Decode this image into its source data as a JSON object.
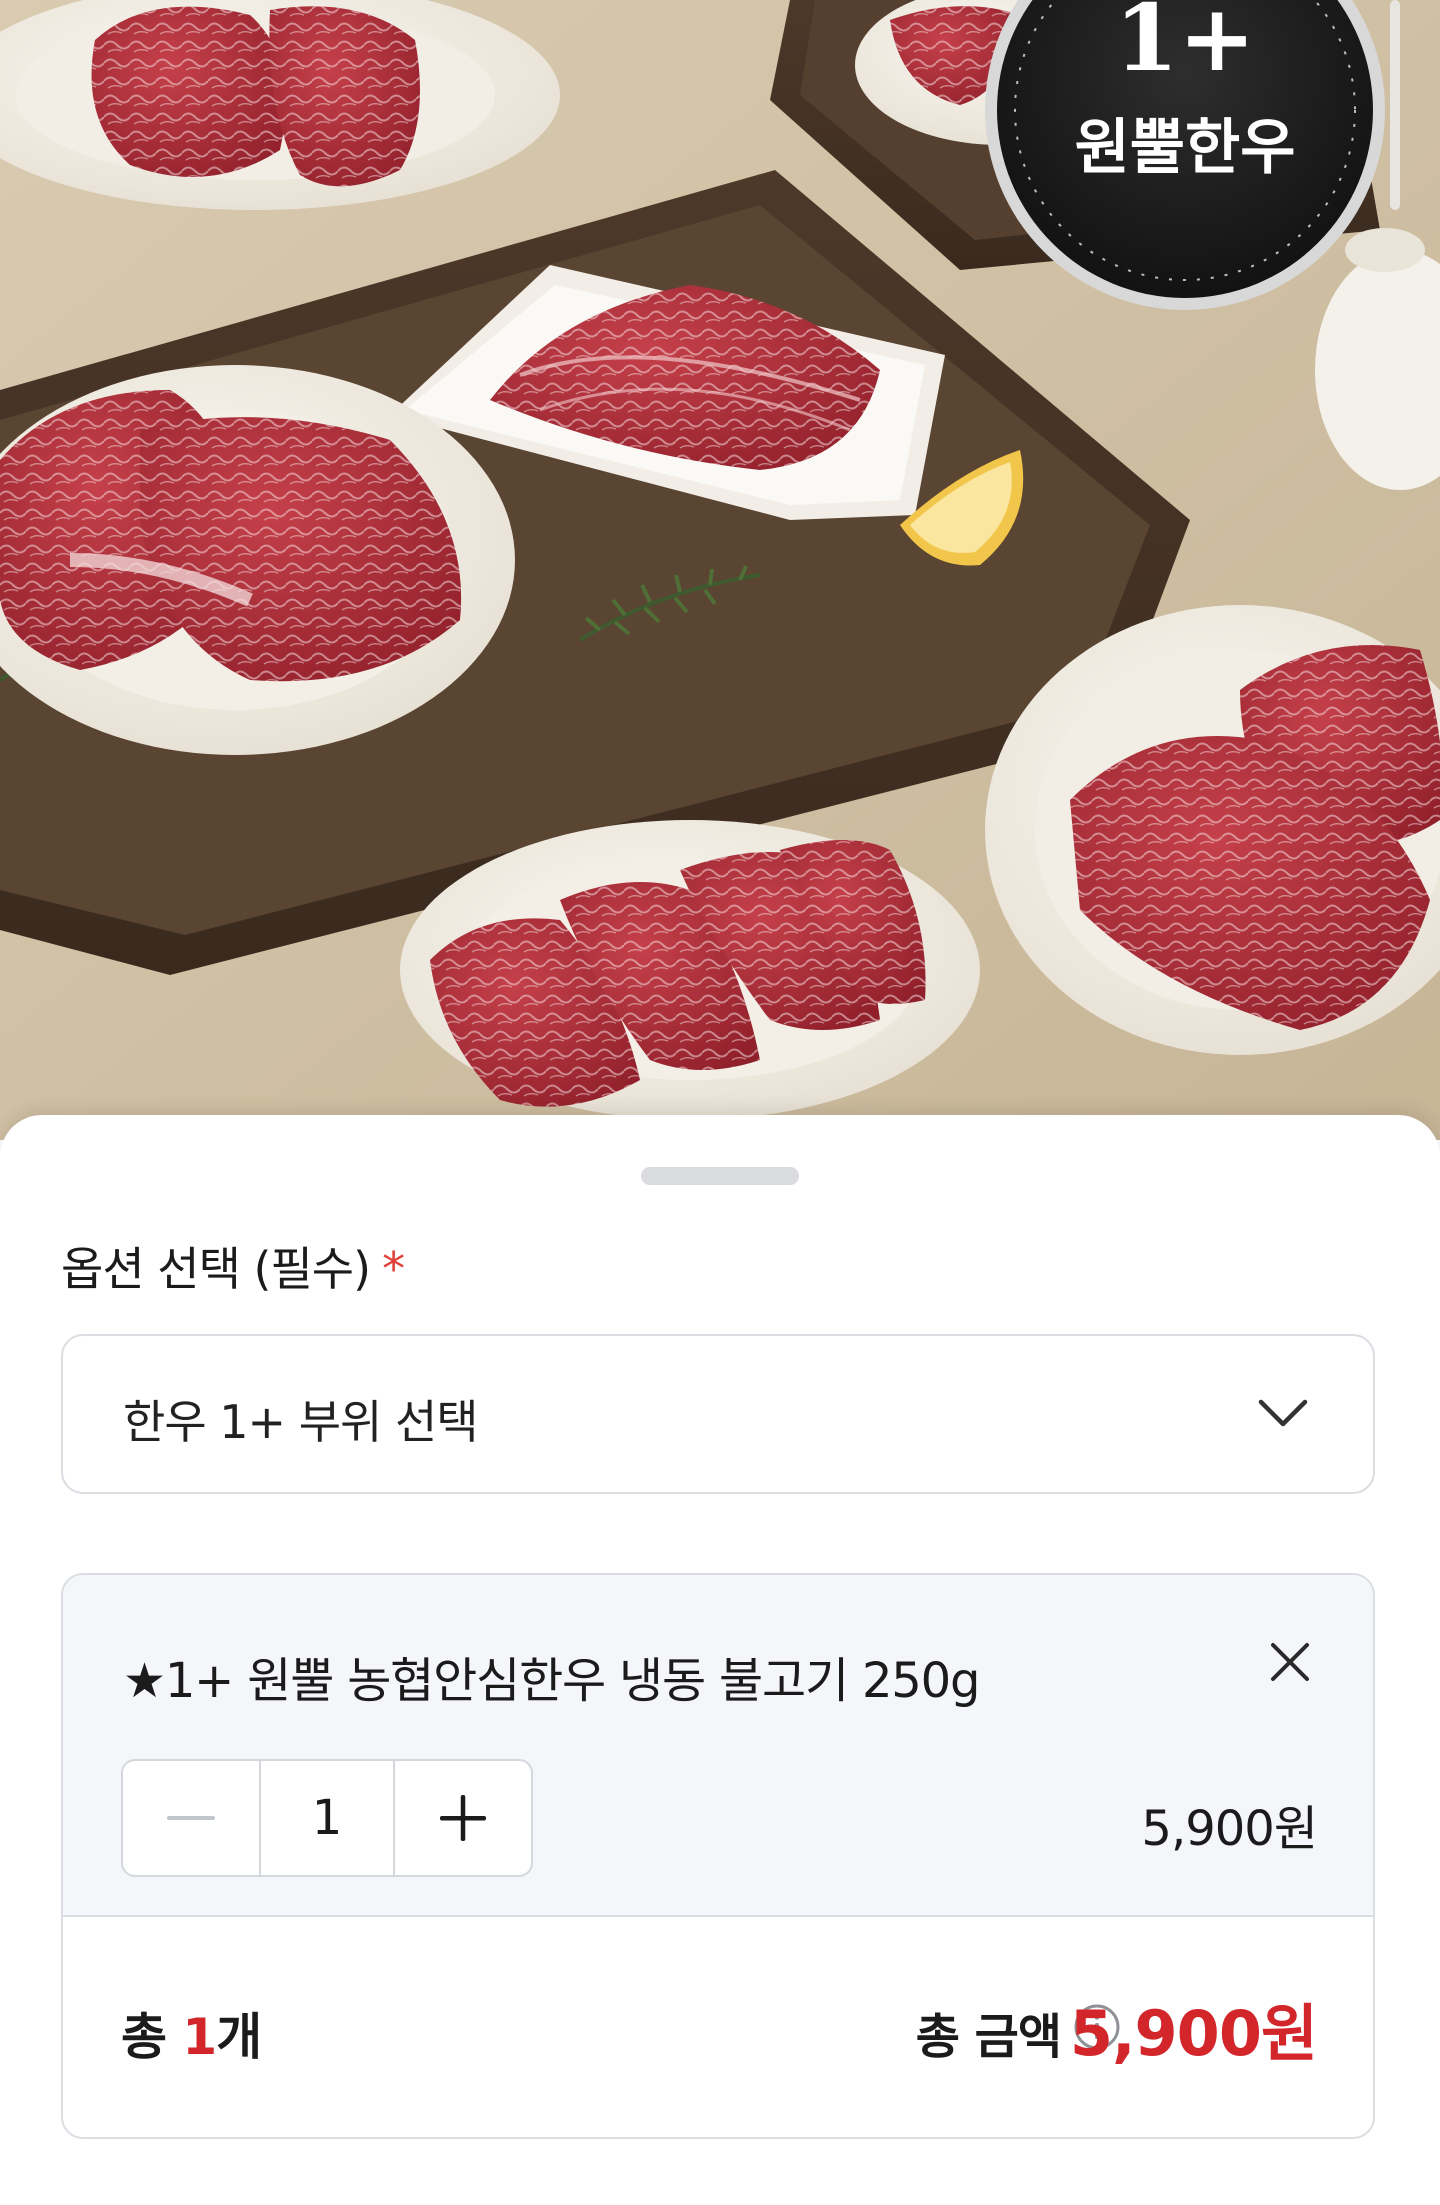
{
  "product_image": {
    "badge_grade": "1+",
    "badge_text": "원뿔한우"
  },
  "option": {
    "section_title": "옵션 선택 (필수)",
    "required_mark": "*",
    "select_value": "한우 1+ 부위 선택"
  },
  "cart_item": {
    "name": "★1+ 원뿔 농협안심한우 냉동 불고기 250g",
    "quantity": "1",
    "price": "5,900원"
  },
  "summary": {
    "count_prefix": "총 ",
    "count_value": "1",
    "count_suffix": "개",
    "amount_label": "총 금액",
    "amount_value": "5,900원"
  },
  "colors": {
    "accent_red": "#d2262b",
    "required_red": "#e0403a",
    "item_background": "#f4f6fa",
    "border": "#dadde2"
  },
  "icons": {
    "select_chevron": "chevron-down-icon",
    "remove": "close-icon",
    "decrease": "minus-icon",
    "increase": "plus-icon",
    "info": "info-icon"
  }
}
